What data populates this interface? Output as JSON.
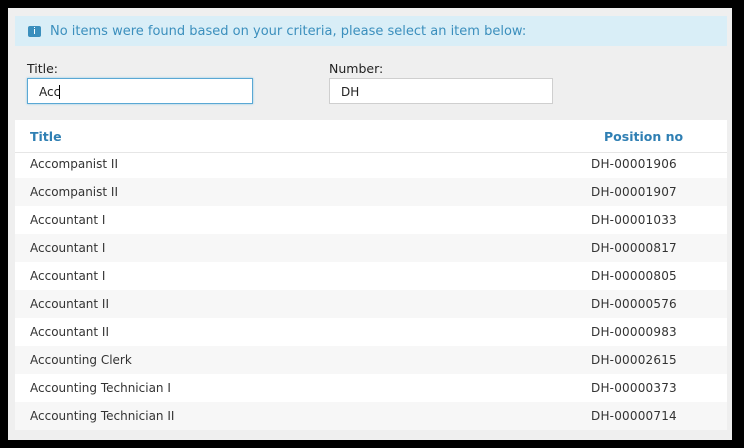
{
  "message": "No items were found based on your criteria, please select an item below:",
  "filters": {
    "title_label": "Title:",
    "title_value": "Acc",
    "number_label": "Number:",
    "number_value": "DH"
  },
  "table": {
    "columns": [
      "Title",
      "Position no"
    ],
    "rows": [
      [
        "Accompanist II",
        "DH-00001906"
      ],
      [
        "Accompanist II",
        "DH-00001907"
      ],
      [
        "Accountant I",
        "DH-00001033"
      ],
      [
        "Accountant I",
        "DH-00000817"
      ],
      [
        "Accountant I",
        "DH-00000805"
      ],
      [
        "Accountant II",
        "DH-00000576"
      ],
      [
        "Accountant II",
        "DH-00000983"
      ],
      [
        "Accounting Clerk",
        "DH-00002615"
      ],
      [
        "Accounting Technician I",
        "DH-00000373"
      ],
      [
        "Accounting Technician II",
        "DH-00000714"
      ]
    ]
  },
  "colors": {
    "accent": "#2f7fb3",
    "info_bg": "#d9eef7"
  }
}
